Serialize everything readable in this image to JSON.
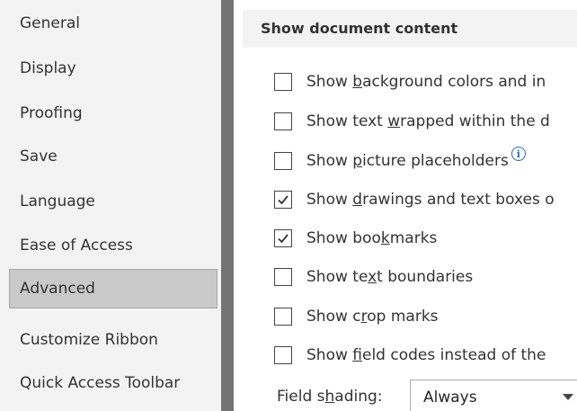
{
  "sidebar": {
    "items": [
      {
        "label": "General",
        "selected": false
      },
      {
        "label": "Display",
        "selected": false
      },
      {
        "label": "Proofing",
        "selected": false
      },
      {
        "label": "Save",
        "selected": false
      },
      {
        "label": "Language",
        "selected": false
      },
      {
        "label": "Ease of Access",
        "selected": false
      },
      {
        "label": "Advanced",
        "selected": true
      },
      {
        "label": "Customize Ribbon",
        "selected": false
      },
      {
        "label": "Quick Access Toolbar",
        "selected": false
      }
    ]
  },
  "section": {
    "title": "Show document content"
  },
  "options": [
    {
      "pre": "Show ",
      "key": "b",
      "post": "ackground colors and in",
      "checked": false
    },
    {
      "pre": "Show text ",
      "key": "w",
      "post": "rapped within the d",
      "checked": false
    },
    {
      "pre": "Show ",
      "key": "p",
      "post": "icture placeholders",
      "checked": false,
      "info_icon": "info-icon"
    },
    {
      "pre": "Show ",
      "key": "d",
      "post": "rawings and text boxes o",
      "checked": true
    },
    {
      "pre": "Show boo",
      "key": "k",
      "post": "marks",
      "checked": true
    },
    {
      "pre": "Show te",
      "key": "x",
      "post": "t boundaries",
      "checked": false
    },
    {
      "pre": "Show c",
      "key": "r",
      "post": "op marks",
      "checked": false
    },
    {
      "pre": "Show ",
      "key": "f",
      "post": "ield codes instead of the",
      "checked": false
    }
  ],
  "field_shading": {
    "label_pre": "Field s",
    "label_key": "h",
    "label_post": "ading:",
    "value": "Always"
  },
  "colors": {
    "sidebar_bg": "#f3f3f3",
    "selected_bg": "#c9c9c9",
    "splitter": "#747474",
    "info_blue": "#2b6cc4"
  }
}
